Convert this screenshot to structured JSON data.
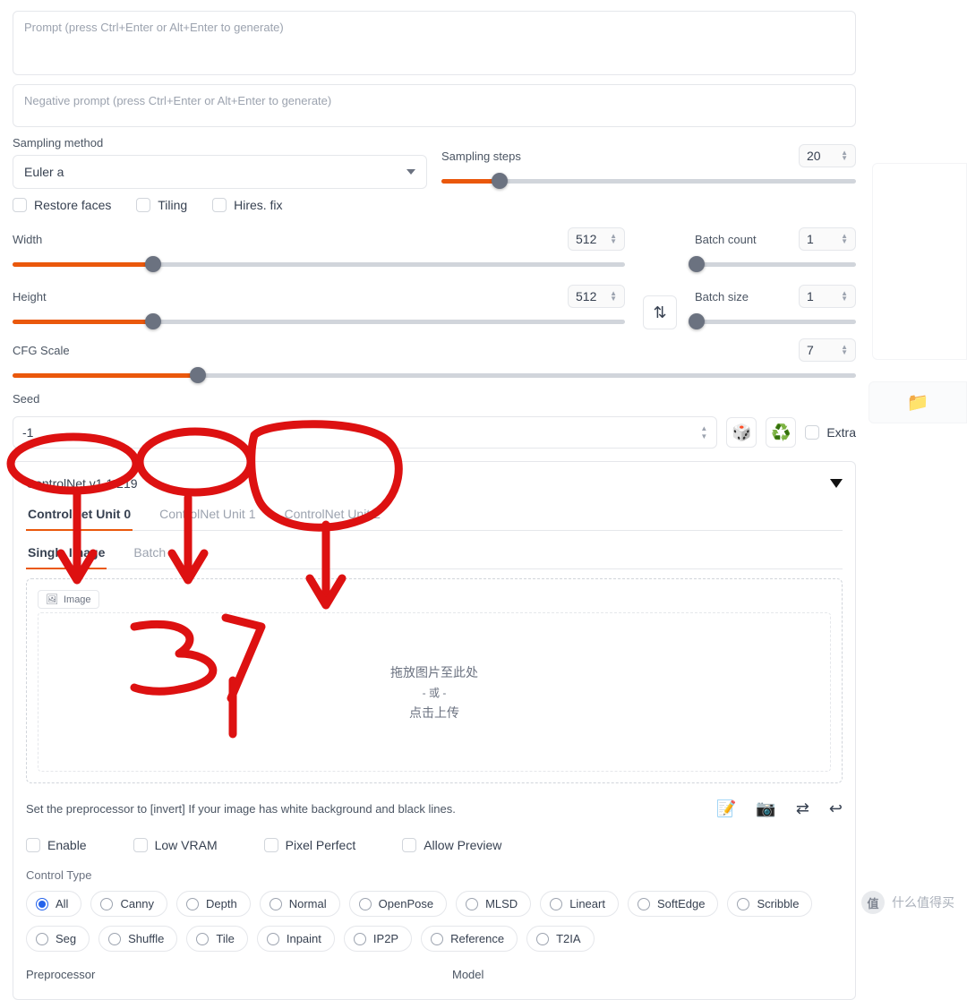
{
  "prompt": {
    "placeholder": "Prompt (press Ctrl+Enter or Alt+Enter to generate)"
  },
  "neg_prompt": {
    "placeholder": "Negative prompt (press Ctrl+Enter or Alt+Enter to generate)"
  },
  "sampling_method": {
    "label": "Sampling method",
    "value": "Euler a"
  },
  "sampling_steps": {
    "label": "Sampling steps",
    "value": "20",
    "percent": 14
  },
  "checks1": {
    "restore": "Restore faces",
    "tiling": "Tiling",
    "hires": "Hires. fix"
  },
  "width": {
    "label": "Width",
    "value": "512",
    "percent": 23
  },
  "height": {
    "label": "Height",
    "value": "512",
    "percent": 23
  },
  "batch_count": {
    "label": "Batch count",
    "value": "1",
    "percent": 0
  },
  "batch_size": {
    "label": "Batch size",
    "value": "1",
    "percent": 0
  },
  "cfg": {
    "label": "CFG Scale",
    "value": "7",
    "percent": 22
  },
  "seed": {
    "label": "Seed",
    "value": "-1",
    "extra": "Extra"
  },
  "controlnet": {
    "title": "ControlNet v1.1.219",
    "units": [
      "ControlNet Unit 0",
      "ControlNet Unit 1",
      "ControlNet Unit 2"
    ],
    "subtabs": [
      "Single Image",
      "Batch"
    ],
    "image_label": "Image",
    "drop_line1": "拖放图片至此处",
    "drop_or": "- 或 -",
    "drop_line2": "点击上传",
    "preproc_note": "Set the preprocessor to [invert] If your image has white background and black lines.",
    "opts": {
      "enable": "Enable",
      "lowvram": "Low VRAM",
      "pixel": "Pixel Perfect",
      "preview": "Allow Preview"
    },
    "control_type_label": "Control Type",
    "types": [
      "All",
      "Canny",
      "Depth",
      "Normal",
      "OpenPose",
      "MLSD",
      "Lineart",
      "SoftEdge",
      "Scribble",
      "Seg",
      "Shuffle",
      "Tile",
      "Inpaint",
      "IP2P",
      "Reference",
      "T2IA"
    ],
    "preprocessor_label": "Preprocessor",
    "model_label": "Model"
  },
  "footer": {
    "brand": "什么值得买",
    "mark": "值"
  },
  "annotation": {
    "text": "3个"
  }
}
